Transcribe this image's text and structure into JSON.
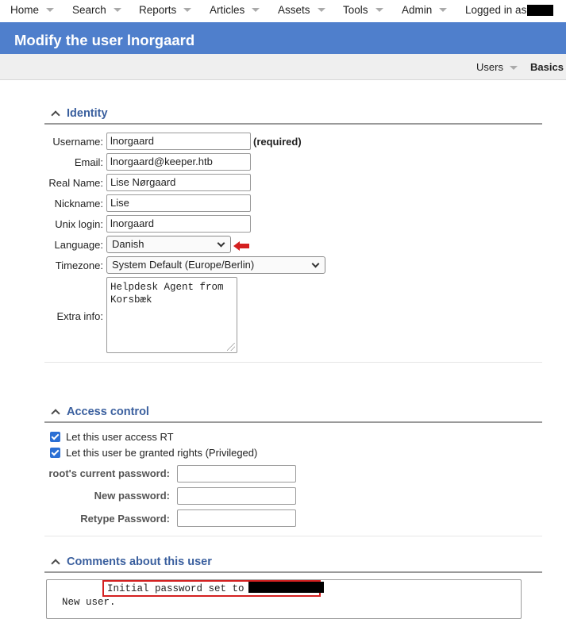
{
  "menu": {
    "items": [
      "Home",
      "Search",
      "Reports",
      "Articles",
      "Assets",
      "Tools",
      "Admin"
    ],
    "logged_in_label": "Logged in as"
  },
  "header": {
    "title": "Modify the user lnorgaard"
  },
  "pagenav": {
    "users": "Users",
    "basics": "Basics"
  },
  "identity": {
    "section_title": "Identity",
    "username_label": "Username:",
    "username_value": "lnorgaard",
    "required_note": "(required)",
    "email_label": "Email:",
    "email_value": "lnorgaard@keeper.htb",
    "realname_label": "Real Name:",
    "realname_value": "Lise Nørgaard",
    "nickname_label": "Nickname:",
    "nickname_value": "Lise",
    "unixlogin_label": "Unix login:",
    "unixlogin_value": "lnorgaard",
    "language_label": "Language:",
    "language_value": "Danish",
    "timezone_label": "Timezone:",
    "timezone_value": "System Default (Europe/Berlin)",
    "extrainfo_label": "Extra info:",
    "extrainfo_value": "Helpdesk Agent from\nKorsbæk"
  },
  "access": {
    "section_title": "Access control",
    "access_rt_label": "Let this user access RT",
    "access_rt_checked": true,
    "privileged_label": "Let this user be granted rights (Privileged)",
    "privileged_checked": true,
    "current_password_label": "root's current password:",
    "new_password_label": "New password:",
    "retype_password_label": "Retype Password:"
  },
  "comments": {
    "section_title": "Comments about this user",
    "text_prefix": "New user.",
    "text_highlight": "Initial password set to"
  },
  "colors": {
    "header_bg": "#4f7fcc",
    "section_title": "#3a5f9e",
    "checkbox": "#2a6fd4",
    "annotation_red": "#d42020"
  }
}
